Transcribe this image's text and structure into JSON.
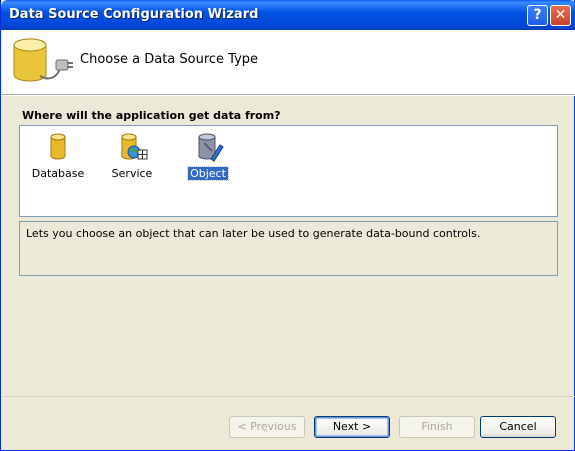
{
  "window": {
    "title": "Data Source Configuration Wizard"
  },
  "titlebar_buttons": {
    "help": "?",
    "close": "✕"
  },
  "header": {
    "title": "Choose a Data Source Type"
  },
  "question": "Where will the application get data from?",
  "types": [
    {
      "label": "Database",
      "icon": "database-icon",
      "selected": false
    },
    {
      "label": "Service",
      "icon": "service-icon",
      "selected": false
    },
    {
      "label": "Object",
      "icon": "object-icon",
      "selected": true
    }
  ],
  "description": "Lets you choose an object that can later be used to generate data-bound controls.",
  "buttons": {
    "previous": "< Previous",
    "next": "Next >",
    "finish": "Finish",
    "cancel": "Cancel"
  },
  "colors": {
    "titlebar": "#0054e3",
    "selection": "#316ac5",
    "dialog": "#ece9d8"
  }
}
